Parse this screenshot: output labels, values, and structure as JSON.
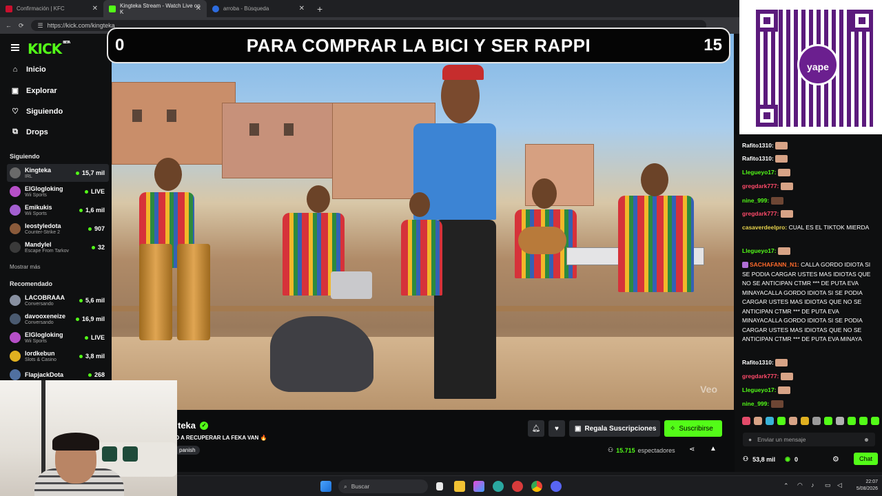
{
  "browser": {
    "tabs": [
      {
        "label": "Confirmación | KFC",
        "active": false
      },
      {
        "label": "Kingteka Stream - Watch Live on K",
        "active": true
      },
      {
        "label": "arroba - Búsqueda",
        "active": false
      }
    ],
    "url": "https://kick.com/kingteka"
  },
  "sidebar": {
    "logo": "KICK",
    "beta": "BETA",
    "nav": [
      {
        "label": "Inicio",
        "icon": "home-icon",
        "glyph": "⌂"
      },
      {
        "label": "Explorar",
        "icon": "compass-icon",
        "glyph": "▣"
      },
      {
        "label": "Siguiendo",
        "icon": "heart-icon",
        "glyph": "♡"
      },
      {
        "label": "Drops",
        "icon": "gift-icon",
        "glyph": "⧉"
      }
    ],
    "following_title": "Siguiendo",
    "following": [
      {
        "name": "Kingteka",
        "category": "IRL",
        "viewers": "15,7 mil",
        "color": "#6a6a6a"
      },
      {
        "name": "ElGlogloking",
        "category": "Wii Sports",
        "viewers": "LIVE",
        "color": "#b64fc8"
      },
      {
        "name": "Emikukis",
        "category": "Wii Sports",
        "viewers": "1,6 mil",
        "color": "#a35fd0"
      },
      {
        "name": "leostyledota",
        "category": "Counter-Strike 2",
        "viewers": "907",
        "color": "#8a5a3a"
      },
      {
        "name": "Mandylel",
        "category": "Escape From Tarkov",
        "viewers": "32",
        "color": "#3a3a3a"
      }
    ],
    "show_more": "Mostrar más",
    "recommended_title": "Recomendado",
    "recommended": [
      {
        "name": "LACOBRAAA",
        "category": "Conversando",
        "viewers": "5,6 mil",
        "color": "#8890a0"
      },
      {
        "name": "davooxeneize",
        "category": "Conversando",
        "viewers": "16,9 mil",
        "color": "#4a5a70"
      },
      {
        "name": "ElGlogloking",
        "category": "Wii Sports",
        "viewers": "LIVE",
        "color": "#b64fc8"
      },
      {
        "name": "lordkebun",
        "category": "Slots & Casino",
        "viewers": "3,8 mil",
        "color": "#e0b020"
      },
      {
        "name": "FlapjackDota",
        "category": "",
        "viewers": "268",
        "color": "#5070a0"
      }
    ]
  },
  "overlay": {
    "left_number": "0",
    "text": "PARA COMPRAR LA BICI Y SER RAPPI",
    "right_number": "15"
  },
  "video": {
    "watermark": "Veo"
  },
  "stream": {
    "name": "teka",
    "title": "O A RECUPERAR LA FEKA VAN 🔥",
    "tag": "panish",
    "gift_label": "Regala Suscripciones",
    "subscribe_label": "Suscribirse",
    "viewers": "15.715",
    "viewers_label": "espectadores"
  },
  "chat": {
    "messages": [
      {
        "user": "Rafito1310:",
        "color": "#ffffff",
        "text": "",
        "emote": true
      },
      {
        "user": "Rafito1310:",
        "color": "#ffffff",
        "text": "",
        "emote": true
      },
      {
        "user": "Llegueyo17:",
        "color": "#53fc18",
        "text": "",
        "emote": true
      },
      {
        "user": "gregdark777:",
        "color": "#ff4a6a",
        "text": "",
        "emote": true
      },
      {
        "user": "nine_999:",
        "color": "#53fc18",
        "text": "",
        "emote": true
      },
      {
        "user": "gregdark777:",
        "color": "#ff4a6a",
        "text": "",
        "emote": true
      },
      {
        "user": "casaverdeelpro:",
        "color": "#e8d44d",
        "text": "CUAL ES EL TIKTOK MIERDA",
        "emote": false
      },
      {
        "user": "Llegueyo17:",
        "color": "#53fc18",
        "text": "",
        "emote": true
      },
      {
        "user": "SACHAFANN_N1:",
        "color": "#ff6a2b",
        "text": "CALLA GORDO IDIOTA SI SE PODIA CARGAR USTES MAS IDIOTAS QUE NO SE ANTICIPAN CTMR *** DE PUTA EVA MINAYACALLA GORDO IDIOTA SI SE PODIA CARGAR USTES MAS IDIOTAS QUE NO SE ANTICIPAN CTMR *** DE PUTA EVA MINAYACALLA GORDO IDIOTA SI SE PODIA CARGAR USTES MAS IDIOTAS QUE NO SE ANTICIPAN CTMR *** DE PUTA EVA MINAYA",
        "emote": false
      },
      {
        "user": "Rafito1310:",
        "color": "#ffffff",
        "text": "",
        "emote": true
      },
      {
        "user": "gregdark777:",
        "color": "#ff4a6a",
        "text": "",
        "emote": true
      },
      {
        "user": "Llegueyo17:",
        "color": "#53fc18",
        "text": "",
        "emote": true
      },
      {
        "user": "nine_999:",
        "color": "#53fc18",
        "text": "",
        "emote": true
      }
    ],
    "input_placeholder": "Enviar un mensaje",
    "followers": "53,8 mil",
    "kicks": "0",
    "chat_button": "Chat"
  },
  "taskbar": {
    "search_placeholder": "Buscar",
    "time": "22:07",
    "date": "5/08/2026"
  },
  "colors": {
    "accent": "#53fc18",
    "background": "#0b0c0d"
  }
}
